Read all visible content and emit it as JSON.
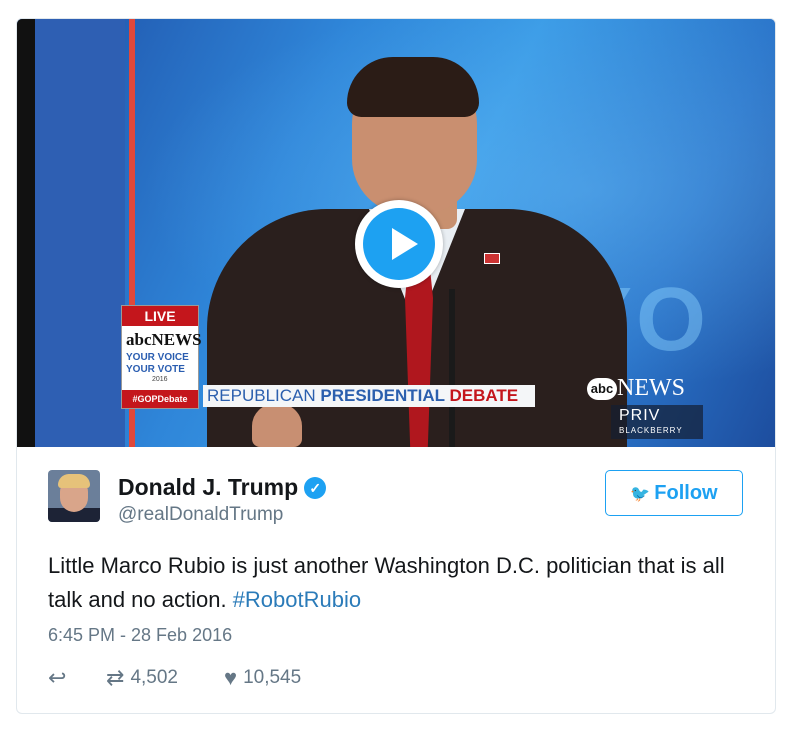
{
  "video": {
    "overlay": {
      "live": "LIVE",
      "abc_news_small": "abcNEWS",
      "your_voice": "YOUR VOICE",
      "your_vote": "YOUR VOTE",
      "year": "2016",
      "gop_hashtag": "#GOPDebate",
      "banner_part1": "REPUBLICAN ",
      "banner_part2": "PRESIDENTIAL ",
      "banner_part3": "DEBATE",
      "abc_logo": "abc",
      "news": "NEWS",
      "priv": "PRIV",
      "blackberry": "BLACKBERRY",
      "background_word": "YO"
    }
  },
  "tweet": {
    "author_name": "Donald J. Trump",
    "handle": "@realDonaldTrump",
    "follow_label": "Follow",
    "text_main": "Little Marco Rubio is just another Washington D.C. politician that is all talk and no action. ",
    "hashtag": "#RobotRubio",
    "timestamp": "6:45 PM - 28 Feb 2016",
    "retweets": "4,502",
    "likes": "10,545"
  },
  "colors": {
    "twitter_blue": "#1da1f2",
    "hashtag_blue": "#2b7bb9",
    "text_gray": "#657786"
  }
}
